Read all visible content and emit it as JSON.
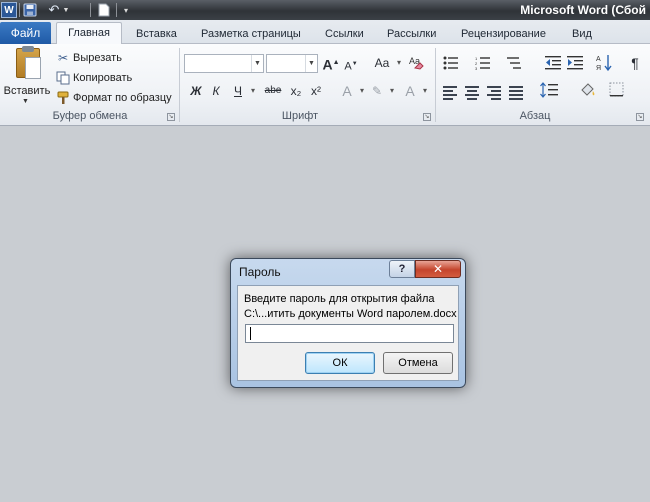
{
  "window": {
    "title": "Microsoft Word (Сбой",
    "app_logo": "W"
  },
  "quick_access": {
    "icons": [
      "word-logo-icon",
      "save-icon",
      "undo-icon",
      "new-document-icon"
    ]
  },
  "tabs": {
    "file": "Файл",
    "items": [
      {
        "label": "Главная",
        "active": true
      },
      {
        "label": "Вставка"
      },
      {
        "label": "Разметка страницы"
      },
      {
        "label": "Ссылки"
      },
      {
        "label": "Рассылки"
      },
      {
        "label": "Рецензирование"
      },
      {
        "label": "Вид"
      }
    ]
  },
  "ribbon": {
    "clipboard": {
      "label": "Буфер обмена",
      "paste": "Вставить",
      "cut": "Вырезать",
      "copy": "Копировать",
      "format_painter": "Формат по образцу"
    },
    "font": {
      "label": "Шрифт",
      "font_name": "",
      "font_size": "",
      "bold": "Ж",
      "italic": "К",
      "underline": "Ч",
      "strikethrough": "abe",
      "subscript": "x₂",
      "superscript": "x²",
      "grow": "A",
      "shrink": "A",
      "change_case": "Aa",
      "font_color": "A"
    },
    "paragraph": {
      "label": "Абзац"
    }
  },
  "dialog": {
    "title": "Пароль",
    "help": "?",
    "close": "✕",
    "prompt": "Введите пароль для открытия файла",
    "filepath": "C:\\...итить документы Word паролем.docx",
    "password_value": "",
    "ok": "ОК",
    "cancel": "Отмена"
  },
  "colors": {
    "file_tab": "#2a64b0",
    "workspace": "#c9cdd2",
    "close_button": "#c4452d"
  }
}
